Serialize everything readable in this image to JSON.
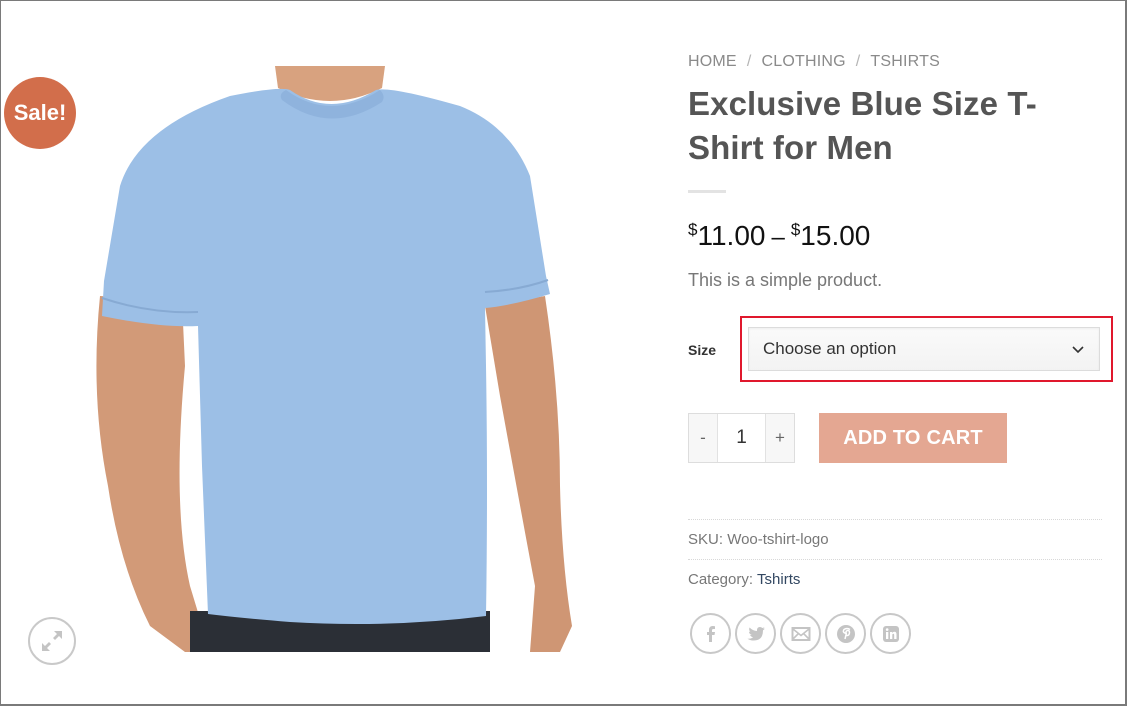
{
  "badge": {
    "label": "Sale!",
    "color": "#d26e4b"
  },
  "gallery": {
    "image_alt": "Blue t-shirt worn by model",
    "zoom_icon": "expand-icon"
  },
  "breadcrumb": {
    "items": [
      "HOME",
      "CLOTHING",
      "TSHIRTS"
    ],
    "separator": "/"
  },
  "product": {
    "title": "Exclusive Blue Size T-Shirt for Men",
    "price": {
      "currency": "$",
      "min": "11.00",
      "max": "15.00",
      "dash": "–"
    },
    "short_description": "This is a simple product."
  },
  "variation": {
    "label": "Size",
    "select_value": "Choose an option",
    "highlight_color": "#e0182d"
  },
  "cart": {
    "minus": "-",
    "quantity": "1",
    "plus": "+",
    "add_to_cart_label": "ADD TO CART",
    "button_color": "#e4a792"
  },
  "meta": {
    "sku_label": "SKU:",
    "sku_value": "Woo-tshirt-logo",
    "category_label": "Category:",
    "category_value": "Tshirts"
  },
  "share": {
    "icons": [
      "facebook-icon",
      "twitter-icon",
      "email-icon",
      "pinterest-icon",
      "linkedin-icon"
    ]
  }
}
